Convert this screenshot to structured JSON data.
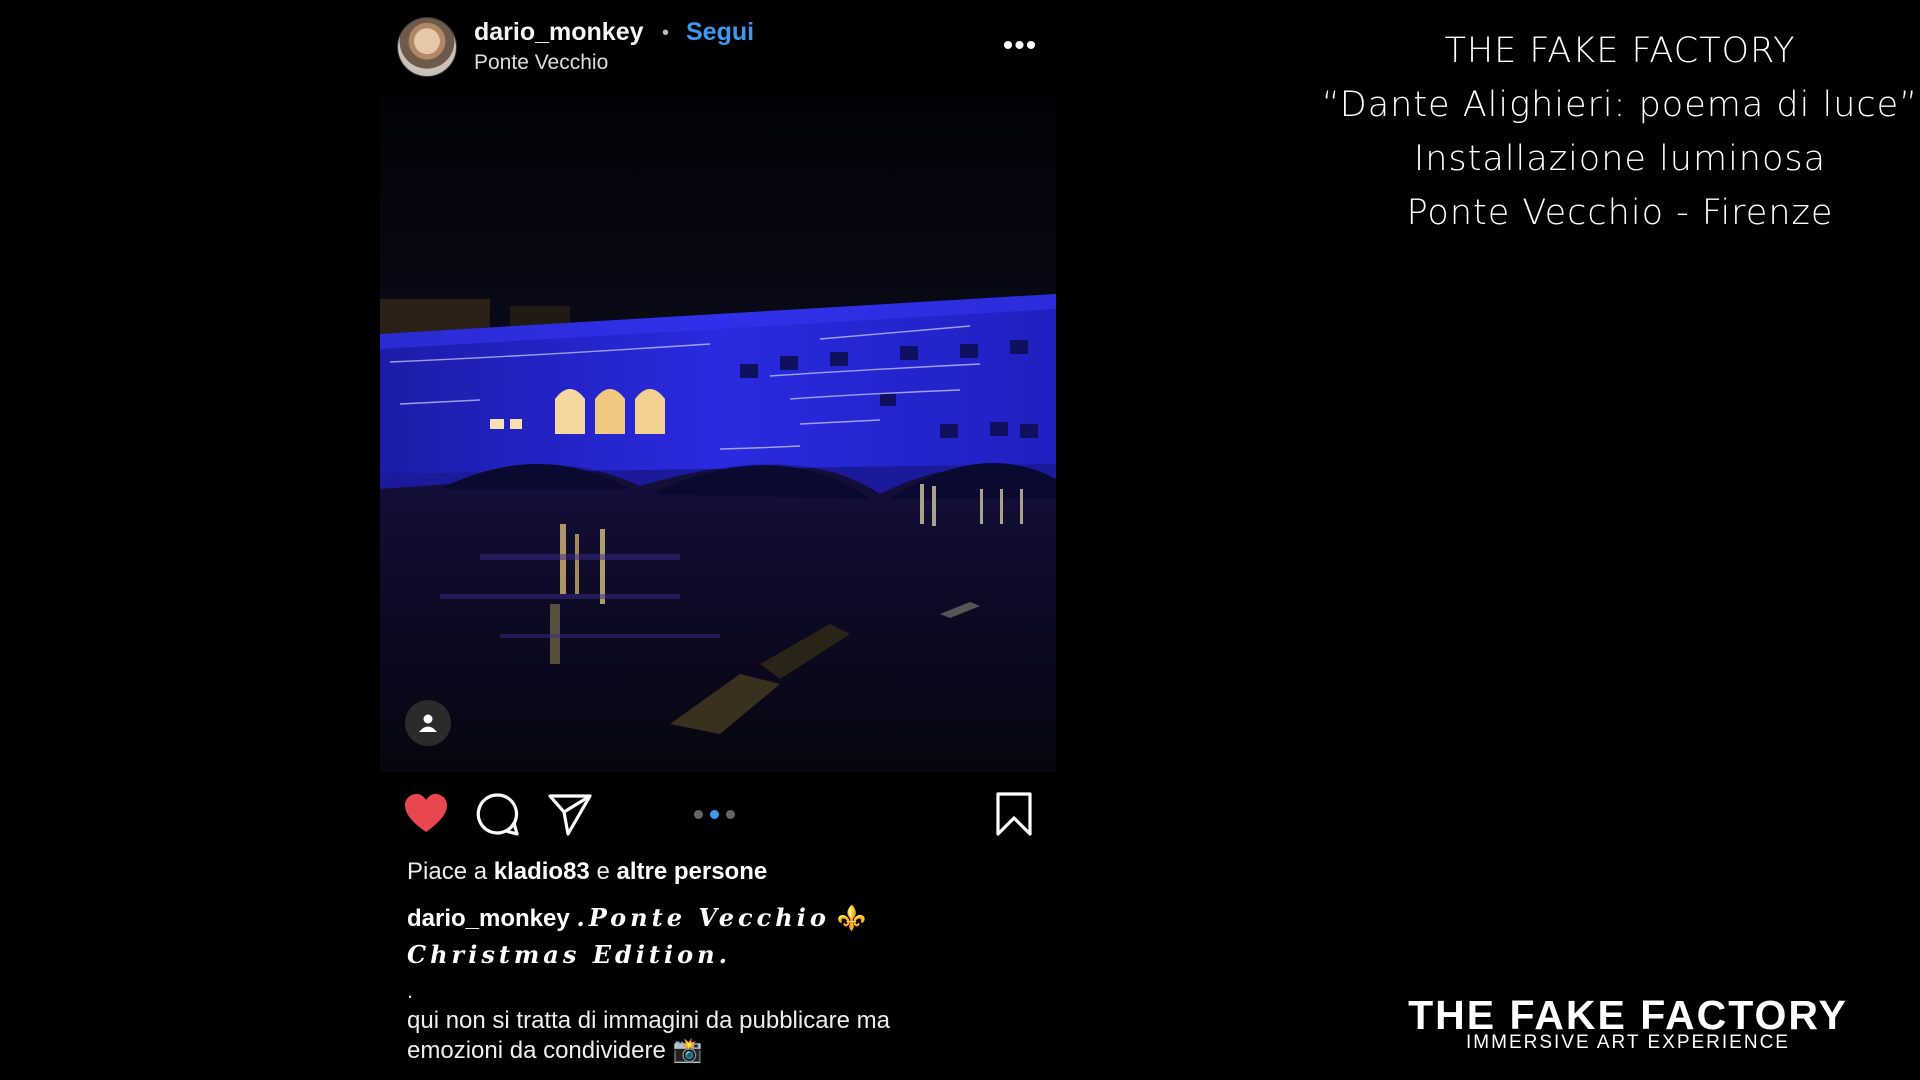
{
  "post": {
    "username": "dario_monkey",
    "separator": "•",
    "follow_label": "Segui",
    "location": "Ponte Vecchio",
    "more_label": "•••",
    "likes": {
      "prefix": "Piace a",
      "user": "kladio83",
      "middle": "e",
      "others": "altre persone"
    },
    "caption": {
      "user": "dario_monkey",
      "text_line1": ".Ponte Vecchio",
      "fleur": "⚜️",
      "text_line2": "Christmas Edition."
    },
    "dot_line": ".",
    "body_line1": "qui non si tratta di immagini da pubblicare ma",
    "body_line2": "emozioni da condividere 📸",
    "pager": {
      "count": 3,
      "active_index": 1
    },
    "icons": {
      "like": "heart-icon",
      "comment": "comment-icon",
      "share": "send-icon",
      "save": "bookmark-icon",
      "tag": "user-tag-icon"
    },
    "colors": {
      "like": "#e8474f",
      "follow": "#3e97f0",
      "background": "#000000"
    }
  },
  "info": {
    "line1": "THE FAKE FACTORY",
    "line2": "“Dante Alighieri: poema di luce”",
    "line3": "Installazione luminosa",
    "line4": "Ponte Vecchio - Firenze"
  },
  "brand": {
    "name": "THE FAKE FACTORY",
    "tagline": "IMMERSIVE ART EXPERIENCE"
  }
}
